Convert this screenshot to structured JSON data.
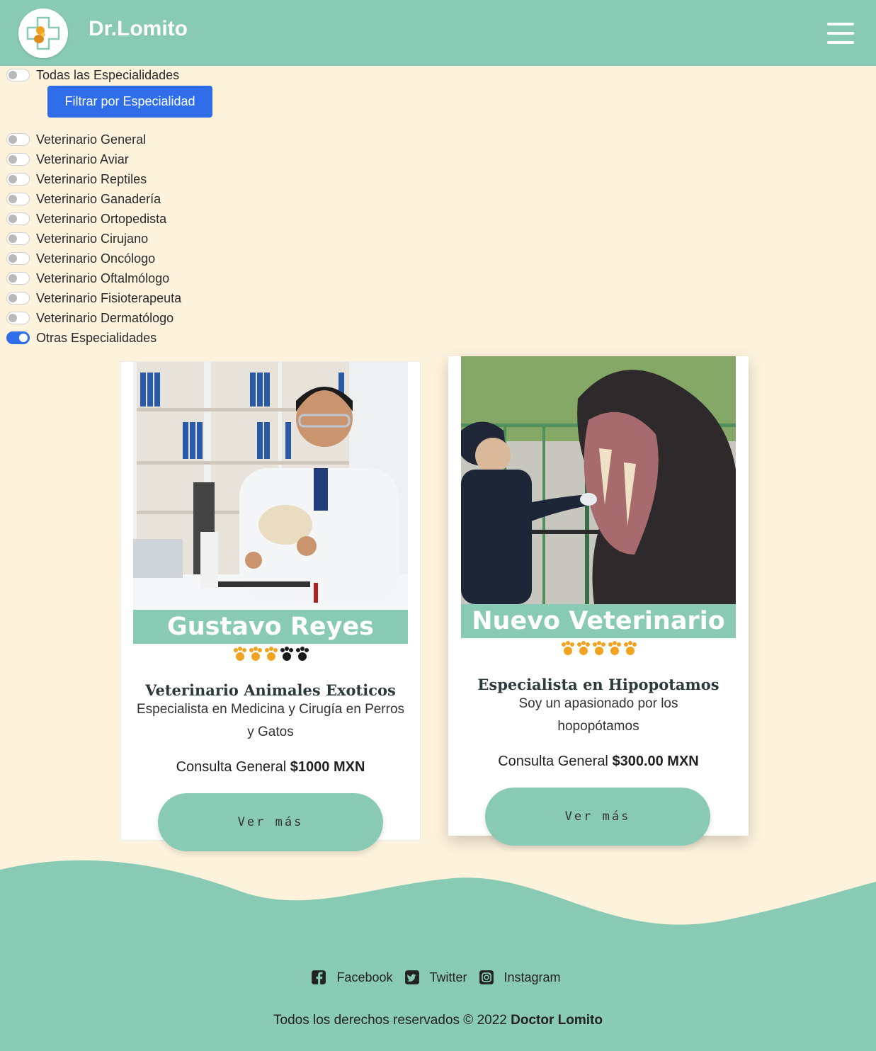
{
  "header": {
    "brand": "Dr.Lomito",
    "logo_icon": "dog-cross-logo-icon",
    "menu_icon": "hamburger-menu-icon"
  },
  "filters": {
    "all_label": "Todas las Especialidades",
    "all_on": false,
    "filter_button": "Filtrar por Especialidad",
    "options": [
      {
        "label": "Veterinario General",
        "on": false
      },
      {
        "label": "Veterinario Aviar",
        "on": false
      },
      {
        "label": "Veterinario Reptiles",
        "on": false
      },
      {
        "label": "Veterinario Ganadería",
        "on": false
      },
      {
        "label": "Veterinario Ortopedista",
        "on": false
      },
      {
        "label": "Veterinario Cirujano",
        "on": false
      },
      {
        "label": "Veterinario Oncólogo",
        "on": false
      },
      {
        "label": "Veterinario Oftalmólogo",
        "on": false
      },
      {
        "label": "Veterinario Fisioterapeuta",
        "on": false
      },
      {
        "label": "Veterinario Dermatólogo",
        "on": false
      },
      {
        "label": "Otras Especialidades",
        "on": true
      }
    ]
  },
  "cards": [
    {
      "name": "Gustavo Reyes",
      "rating": 3,
      "rating_max": 5,
      "title": "Veterinario Animales Exoticos",
      "description": "Especialista en Medicina y Cirugía en Perros y Gatos",
      "price_prefix": "Consulta General",
      "price": "$1000 MXN",
      "button": "Ver más"
    },
    {
      "name": "Nuevo Veterinario",
      "rating": 5,
      "rating_max": 5,
      "title": "Especialista en Hipopotamos",
      "description": "Soy un apasionado por los hopopótamos",
      "price_prefix": "Consulta General",
      "price": "$300.00 MXN",
      "button": "Ver más"
    }
  ],
  "footer": {
    "social": [
      {
        "label": "Facebook",
        "icon": "facebook-icon"
      },
      {
        "label": "Twitter",
        "icon": "twitter-icon"
      },
      {
        "label": "Instagram",
        "icon": "instagram-icon"
      }
    ],
    "copyright_prefix": "Todos los derechos reservados © 2022",
    "copyright_brand": "Doctor Lomito"
  },
  "colors": {
    "teal": "#88cab4",
    "cream": "#fdf2dc",
    "blue": "#2f6ee8",
    "paw_gold": "#f0a321"
  }
}
